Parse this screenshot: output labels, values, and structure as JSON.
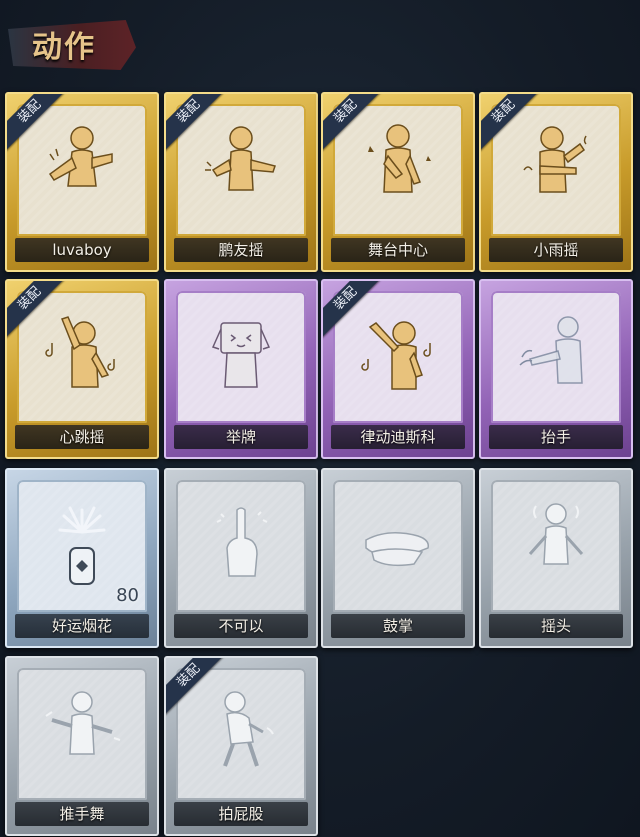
{
  "header": {
    "title": "动作"
  },
  "cards": [
    {
      "label": "luvaboy",
      "badge": "装配",
      "icon": "dance-arms-icon"
    },
    {
      "label": "鹏友摇",
      "badge": "装配",
      "icon": "dance-point-icon"
    },
    {
      "label": "舞台中心",
      "badge": "装配",
      "icon": "dance-stage-icon"
    },
    {
      "label": "小雨摇",
      "badge": "装配",
      "icon": "dance-rain-icon"
    },
    {
      "label": "心跳摇",
      "badge": "装配",
      "icon": "dance-heartbeat-icon"
    },
    {
      "label": "举牌",
      "icon": "hold-sign-icon"
    },
    {
      "label": "律动迪斯科",
      "badge": "装配",
      "icon": "disco-icon"
    },
    {
      "label": "抬手",
      "icon": "raise-hand-icon"
    },
    {
      "label": "好运烟花",
      "count": "80",
      "icon": "firework-icon"
    },
    {
      "label": "不可以",
      "icon": "finger-no-icon"
    },
    {
      "label": "鼓掌",
      "icon": "clap-icon"
    },
    {
      "label": "摇头",
      "icon": "shake-head-icon"
    },
    {
      "label": "推手舞",
      "icon": "push-dance-icon"
    },
    {
      "label": "拍屁股",
      "badge": "装配",
      "icon": "slap-icon"
    }
  ]
}
